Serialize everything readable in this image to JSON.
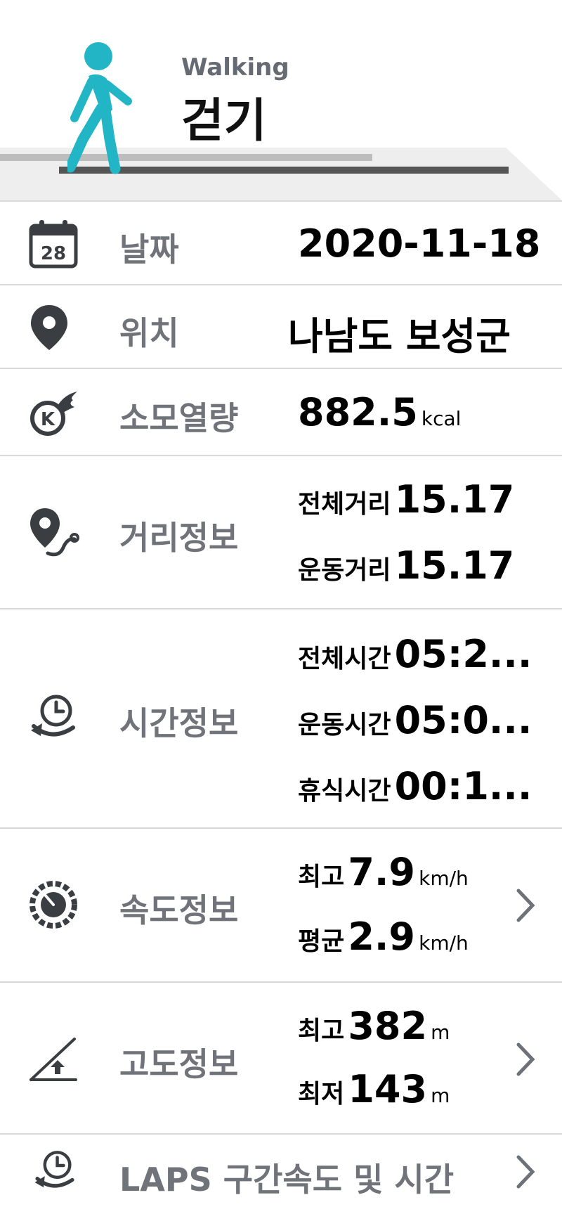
{
  "header": {
    "subtitle": "Walking",
    "title": "걷기"
  },
  "rows": {
    "date": {
      "label": "날짜",
      "value": "2020-11-18",
      "icon": "calendar-icon",
      "calendar_day": "28"
    },
    "location": {
      "label": "위치",
      "value": "나남도 보성군",
      "icon": "location-pin-icon"
    },
    "calories": {
      "label": "소모열량",
      "value": "882.5",
      "unit": "kcal",
      "icon": "calorie-flame-icon"
    },
    "distance": {
      "label": "거리정보",
      "total_label": "전체거리",
      "total_value": "15.17",
      "exercise_label": "운동거리",
      "exercise_value": "15.17",
      "icon": "route-pin-icon"
    },
    "time": {
      "label": "시간정보",
      "total_label": "전체시간",
      "total_value": "05:2...",
      "exercise_label": "운동시간",
      "exercise_value": "05:0...",
      "rest_label": "휴식시간",
      "rest_value": "00:1...",
      "icon": "clock-arrow-icon"
    },
    "speed": {
      "label": "속도정보",
      "max_label": "최고",
      "max_value": "7.9",
      "max_unit": "km/h",
      "avg_label": "평균",
      "avg_value": "2.9",
      "avg_unit": "km/h",
      "icon": "speedometer-icon"
    },
    "altitude": {
      "label": "고도정보",
      "max_label": "최고",
      "max_value": "382",
      "max_unit": "m",
      "min_label": "최저",
      "min_value": "143",
      "min_unit": "m",
      "icon": "altitude-slope-icon"
    },
    "laps": {
      "label": "LAPS 구간속도 및 시간",
      "icon": "clock-arrow-icon"
    }
  },
  "colors": {
    "walker": "#21b5c6",
    "label_gray": "#70747a",
    "divider": "#d9d9d9",
    "icon_dark": "#3a3d42"
  }
}
